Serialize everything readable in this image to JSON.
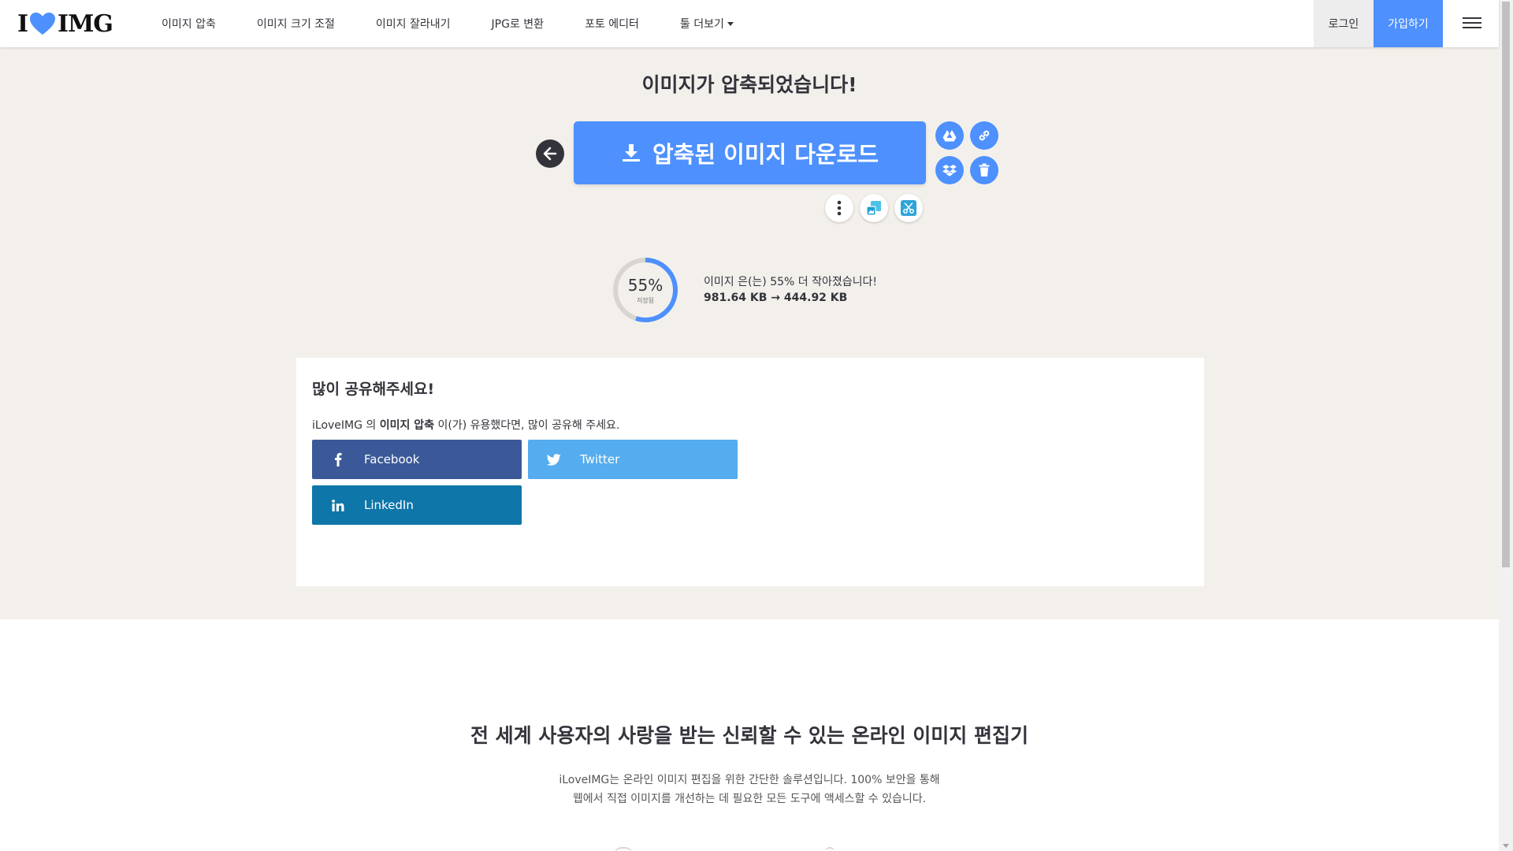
{
  "header": {
    "logo_left": "I",
    "logo_right": "IMG",
    "nav": [
      {
        "label": "이미지 압축"
      },
      {
        "label": "이미지 크기 조절"
      },
      {
        "label": "이미지 잘라내기"
      },
      {
        "label": "JPG로 변환"
      },
      {
        "label": "포토 에디터"
      },
      {
        "label": "툴 더보기"
      }
    ],
    "login": "로그인",
    "signup": "가입하기"
  },
  "result": {
    "title": "이미지가 압축되었습니다!",
    "download_label": "압축된 이미지 다운로드",
    "percent": "55%",
    "percent_value": 55,
    "percent_sub": "저장됨",
    "saved_text": "이미지 은(는) 55% 더 작아졌습니다!",
    "sizes": "981.64 KB → 444.92 KB"
  },
  "share": {
    "title": "많이 공유해주세요!",
    "desc_prefix": "iLoveIMG 의 ",
    "desc_tool": "이미지 압축",
    "desc_suffix": " 이(가) 유용했다면, 많이 공유해 주세요.",
    "facebook": "Facebook",
    "twitter": "Twitter",
    "linkedin": "LinkedIn"
  },
  "lower": {
    "title": "전 세계 사용자의 사랑을 받는 신뢰할 수 있는 온라인 이미지 편집기",
    "desc_line1": "iLoveIMG는 온라인 이미지 편집을 위한 간단한 솔루션입니다. 100% 보안을 통해",
    "desc_line2": "웹에서 직접 이미지를 개선하는 데 필요한 모든 도구에 액세스할 수 있습니다."
  },
  "colors": {
    "accent": "#4d90fe",
    "facebook": "#3b5998",
    "twitter": "#55acee",
    "linkedin": "#0e76a8",
    "logo_heart": "#4d90fe"
  },
  "icons": {
    "download": "download-icon",
    "back": "arrow-left-icon",
    "drive": "google-drive-icon",
    "link": "link-icon",
    "dropbox": "dropbox-icon",
    "delete": "trash-icon",
    "more": "more-vertical-icon",
    "resize": "resize-image-icon",
    "crop": "crop-icon"
  }
}
